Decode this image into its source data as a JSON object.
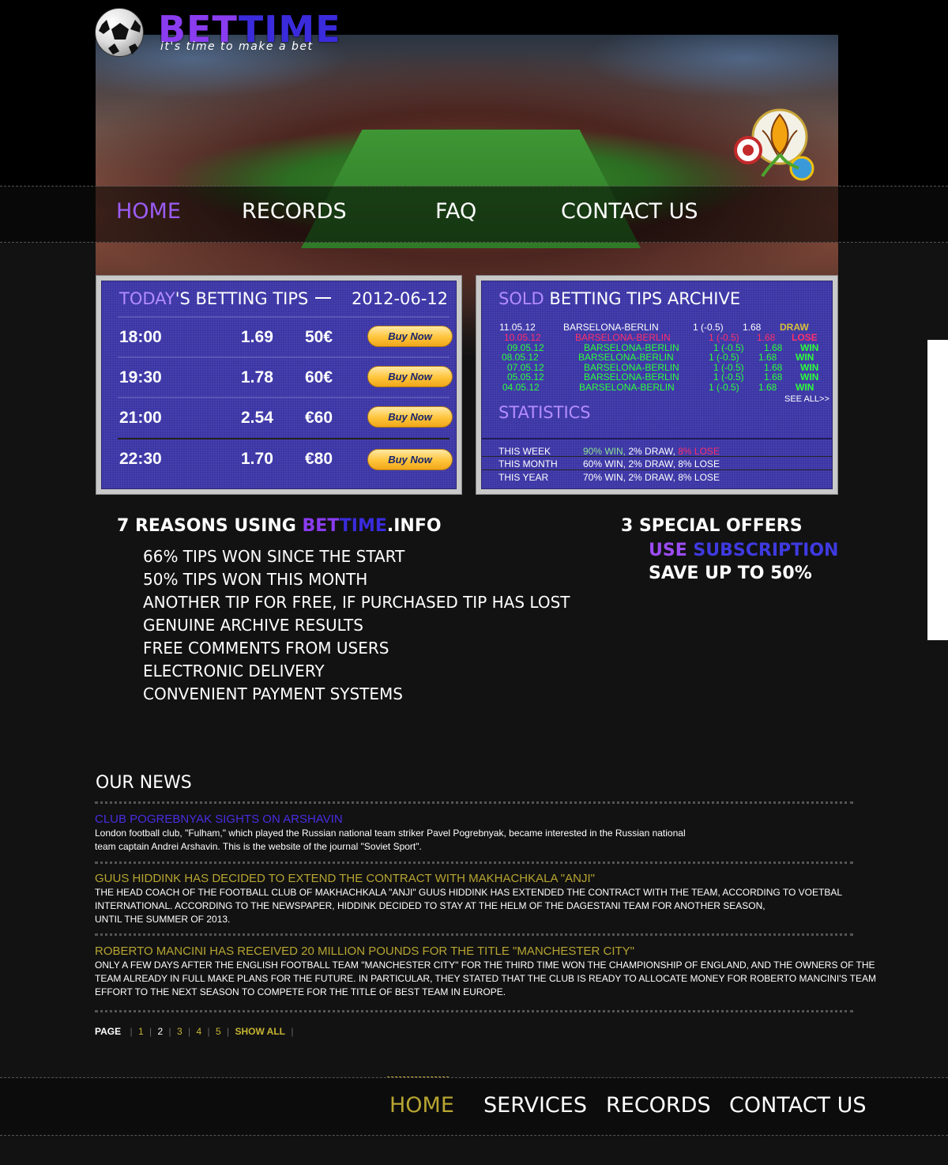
{
  "logo": {
    "text_a": "BET",
    "text_b": "TIME",
    "tagline": "it's time to make a bet"
  },
  "top_nav": [
    {
      "label": "HOME",
      "active": true
    },
    {
      "label": "RECORDS",
      "active": false
    },
    {
      "label": "FAQ",
      "active": false
    },
    {
      "label": "CONTACT US",
      "active": false
    }
  ],
  "tips": {
    "title_hl": "TODAY",
    "title_rest": "'S BETTING TIPS",
    "date": "2012-06-12",
    "buy_label": "Buy Now",
    "rows": [
      {
        "time": "18:00",
        "odds": "1.69",
        "stake": "50€"
      },
      {
        "time": "19:30",
        "odds": "1.78",
        "stake": "60€"
      },
      {
        "time": "21:00",
        "odds": "2.54",
        "stake": "€60"
      },
      {
        "time": "22:30",
        "odds": "1.70",
        "stake": "€80"
      }
    ]
  },
  "archive": {
    "title_hl": "SOLD",
    "title_rest": " BETTING TIPS ARCHIVE",
    "rows": [
      {
        "date": "11.05.12",
        "match": "BARSELONA-BERLIN",
        "tip": "1 (-0.5)",
        "odds": "1.68",
        "result": "DRAW",
        "status": "draw"
      },
      {
        "date": "10.05.12",
        "match": "BARSELONA-BERLIN",
        "tip": "1 (-0.5)",
        "odds": "1.68",
        "result": "LOSE",
        "status": "lose"
      },
      {
        "date": "09.05.12",
        "match": "BARSELONA-BERLIN",
        "tip": "1 (-0.5)",
        "odds": "1.68",
        "result": "WIN",
        "status": "win"
      },
      {
        "date": "08.05.12",
        "match": "BARSELONA-BERLIN",
        "tip": "1 (-0.5)",
        "odds": "1.68",
        "result": "WIN",
        "status": "win"
      },
      {
        "date": "07.05.12",
        "match": "BARSELONA-BERLIN",
        "tip": "1 (-0.5)",
        "odds": "1.68",
        "result": "WIN",
        "status": "win"
      },
      {
        "date": "05.05.12",
        "match": "BARSELONA-BERLIN",
        "tip": "1 (-0.5)",
        "odds": "1.68",
        "result": "WIN",
        "status": "win"
      },
      {
        "date": "04.05.12",
        "match": "BARSELONA-BERLIN",
        "tip": "1 (-0.5)",
        "odds": "1.68",
        "result": "WIN",
        "status": "win"
      }
    ],
    "see_all": "SEE ALL>>"
  },
  "statistics": {
    "title": "STATISTICS",
    "rows": [
      {
        "period": "THIS WEEK",
        "win": "90% WIN,",
        "draw": " 2% DRAW, ",
        "lose": "8% LOSE"
      },
      {
        "period": "THIS MONTH",
        "win": "60% WIN,",
        "draw": " 2% DRAW, ",
        "lose": "8% LOSE"
      },
      {
        "period": "THIS YEAR",
        "win": "70% WIN,",
        "draw": " 2% DRAW, ",
        "lose": "8% LOSE"
      }
    ]
  },
  "reasons": {
    "title_pre": "7 REASONS USING ",
    "title_b1": "BET",
    "title_b2": "TIME",
    "title_post": ".INFO",
    "items": [
      "66% TIPS WON SINCE THE START",
      "50% TIPS WON THIS MONTH",
      "ANOTHER TIP FOR FREE, IF PURCHASED TIP HAS LOST",
      "GENUINE ARCHIVE RESULTS",
      "FREE COMMENTS FROM USERS",
      "ELECTRONIC DELIVERY",
      "CONVENIENT PAYMENT SYSTEMS"
    ]
  },
  "offers": {
    "title": "3 SPECIAL OFFERS",
    "use": "USE ",
    "subscription": "SUBSCRIPTION",
    "save": "SAVE UP TO 50%"
  },
  "news": {
    "heading": "OUR NEWS",
    "items": [
      {
        "title": "CLUB POGREBNYAK SIGHTS ON ARSHAVIN",
        "lines": [
          "London football club, \"Fulham,\" which played the Russian national team striker Pavel Pogrebnyak, became interested in the Russian national",
          "team captain Andrei Arshavin. This is the website of the journal \"Soviet Sport\"."
        ]
      },
      {
        "title": "GUUS HIDDINK HAS DECIDED TO EXTEND THE CONTRACT WITH MAKHACHKALA \"ANJI\"",
        "lines": [
          "THE HEAD COACH OF THE FOOTBALL CLUB OF MAKHACHKALA \"ANJI\" GUUS HIDDINK HAS EXTENDED THE CONTRACT WITH THE TEAM, ACCORDING TO VOETBAL",
          "INTERNATIONAL. ACCORDING TO THE NEWSPAPER, HIDDINK DECIDED TO STAY AT THE HELM OF THE DAGESTANI TEAM FOR ANOTHER SEASON,",
          "UNTIL THE SUMMER OF 2013."
        ]
      },
      {
        "title": "ROBERTO MANCINI HAS RECEIVED 20 MILLION POUNDS FOR THE TITLE \"MANCHESTER CITY\"",
        "lines": [
          "ONLY A FEW DAYS AFTER THE ENGLISH FOOTBALL TEAM \"MANCHESTER CITY\" FOR THE THIRD TIME WON THE CHAMPIONSHIP OF ENGLAND, AND THE OWNERS OF THE",
          "TEAM ALREADY IN FULL MAKE PLANS FOR THE FUTURE. IN PARTICULAR, THEY STATED THAT THE CLUB IS READY TO ALLOCATE MONEY FOR ROBERTO MANCINI'S TEAM",
          "EFFORT TO THE NEXT SEASON TO COMPETE FOR THE TITLE OF BEST TEAM IN EUROPE."
        ]
      }
    ]
  },
  "pager": {
    "label": "PAGE",
    "pages": [
      "1",
      "2",
      "3",
      "4",
      "5"
    ],
    "current": "2",
    "show_all": "SHOW ALL"
  },
  "footer_nav": [
    {
      "label": "HOME",
      "active": true
    },
    {
      "label": "SERVICES",
      "active": false
    },
    {
      "label": "RECORDS",
      "active": false
    },
    {
      "label": "CONTACT US",
      "active": false
    }
  ],
  "colors": {
    "accent_purple": "#8a3cf0",
    "panel_blue": "#3b35a6",
    "win_green": "#2cff39",
    "lose_red": "#ff2f6a",
    "draw_gold": "#d9c13a",
    "news_gold": "#b7a531"
  }
}
